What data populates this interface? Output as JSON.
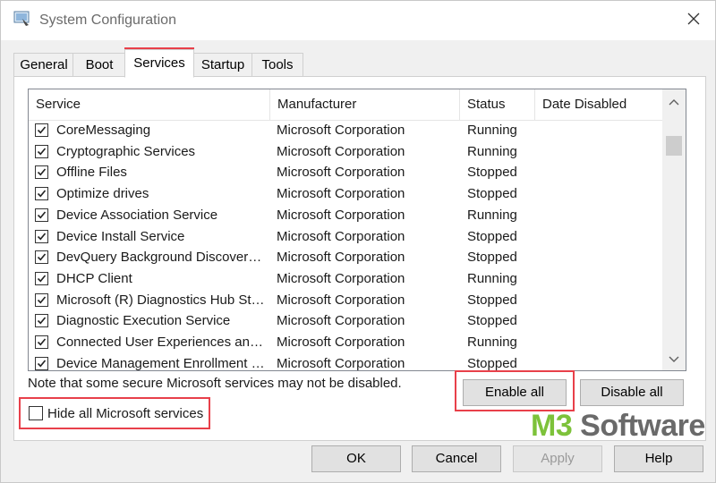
{
  "window": {
    "title": "System Configuration"
  },
  "tabs": [
    {
      "label": "General"
    },
    {
      "label": "Boot"
    },
    {
      "label": "Services"
    },
    {
      "label": "Startup"
    },
    {
      "label": "Tools"
    }
  ],
  "active_tab": "Services",
  "columns": [
    "Service",
    "Manufacturer",
    "Status",
    "Date Disabled"
  ],
  "services": [
    {
      "name": "CoreMessaging",
      "manufacturer": "Microsoft Corporation",
      "status": "Running",
      "checked": true
    },
    {
      "name": "Cryptographic Services",
      "manufacturer": "Microsoft Corporation",
      "status": "Running",
      "checked": true
    },
    {
      "name": "Offline Files",
      "manufacturer": "Microsoft Corporation",
      "status": "Stopped",
      "checked": true
    },
    {
      "name": "Optimize drives",
      "manufacturer": "Microsoft Corporation",
      "status": "Stopped",
      "checked": true
    },
    {
      "name": "Device Association Service",
      "manufacturer": "Microsoft Corporation",
      "status": "Running",
      "checked": true
    },
    {
      "name": "Device Install Service",
      "manufacturer": "Microsoft Corporation",
      "status": "Stopped",
      "checked": true
    },
    {
      "name": "DevQuery Background Discover…",
      "manufacturer": "Microsoft Corporation",
      "status": "Stopped",
      "checked": true
    },
    {
      "name": "DHCP Client",
      "manufacturer": "Microsoft Corporation",
      "status": "Running",
      "checked": true
    },
    {
      "name": "Microsoft (R) Diagnostics Hub St…",
      "manufacturer": "Microsoft Corporation",
      "status": "Stopped",
      "checked": true
    },
    {
      "name": "Diagnostic Execution Service",
      "manufacturer": "Microsoft Corporation",
      "status": "Stopped",
      "checked": true
    },
    {
      "name": "Connected User Experiences an…",
      "manufacturer": "Microsoft Corporation",
      "status": "Running",
      "checked": true
    },
    {
      "name": "Device Management Enrollment …",
      "manufacturer": "Microsoft Corporation",
      "status": "Stopped",
      "checked": true
    }
  ],
  "note": "Note that some secure Microsoft services may not be disabled.",
  "buttons": {
    "enable_all": "Enable all",
    "disable_all": "Disable all",
    "ok": "OK",
    "cancel": "Cancel",
    "apply": "Apply",
    "help": "Help"
  },
  "hide_ms": {
    "label": "Hide all Microsoft services",
    "checked": false
  },
  "watermark": {
    "part1": "M3",
    "part2": " Software"
  },
  "colors": {
    "highlight": "#e8404a",
    "watermark_green": "#7dc23a"
  },
  "icons": {
    "app": "system-configuration-icon",
    "close": "close-icon",
    "scroll_up": "chevron-up-icon",
    "scroll_down": "chevron-down-icon",
    "check": "checkmark-icon"
  }
}
